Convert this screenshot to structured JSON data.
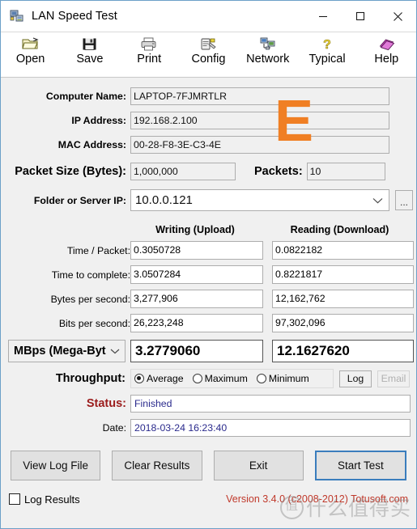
{
  "window": {
    "title": "LAN Speed Test",
    "icon": "app-network-icon",
    "minimize": "–",
    "maximize": "□",
    "close": "✕"
  },
  "toolbar": {
    "items": [
      {
        "label": "Open",
        "icon": "open-folder-icon"
      },
      {
        "label": "Save",
        "icon": "floppy-disk-icon"
      },
      {
        "label": "Print",
        "icon": "printer-icon"
      },
      {
        "label": "Config",
        "icon": "config-gear-icon"
      },
      {
        "label": "Network",
        "icon": "network-icon"
      },
      {
        "label": "Typical",
        "icon": "question-mark-icon"
      },
      {
        "label": "Help",
        "icon": "help-book-icon"
      }
    ]
  },
  "form": {
    "computer_name_label": "Computer Name:",
    "computer_name_value": "LAPTOP-7FJMRTLR",
    "ip_address_label": "IP Address:",
    "ip_address_value": "192.168.2.100",
    "mac_address_label": "MAC Address:",
    "mac_address_value": "00-28-F8-3E-C3-4E",
    "packet_size_label": "Packet Size (Bytes):",
    "packet_size_value": "1,000,000",
    "packets_label": "Packets:",
    "packets_value": "10",
    "folder_label": "Folder or Server IP:",
    "folder_value": "10.0.0.121",
    "browse_button": "...",
    "chevron_icon": "chevron-down-icon"
  },
  "results": {
    "header_write": "Writing (Upload)",
    "header_read": "Reading (Download)",
    "rows": [
      {
        "label": "Time / Packet:",
        "write": "0.3050728",
        "read": "0.0822182"
      },
      {
        "label": "Time to complete:",
        "write": "3.0507284",
        "read": "0.8221817"
      },
      {
        "label": "Bytes per second:",
        "write": "3,277,906",
        "read": "12,162,762"
      },
      {
        "label": "Bits per second:",
        "write": "26,223,248",
        "read": "97,302,096"
      }
    ],
    "unit_selected": "MBps (Mega-Byt",
    "total_write": "3.2779060",
    "total_read": "12.1627620"
  },
  "throughput": {
    "label": "Throughput:",
    "options": [
      {
        "label": "Average",
        "selected": true
      },
      {
        "label": "Maximum",
        "selected": false
      },
      {
        "label": "Minimum",
        "selected": false
      }
    ],
    "log_button": "Log",
    "email_button": "Email"
  },
  "status": {
    "label": "Status:",
    "value": "Finished",
    "date_label": "Date:",
    "date_value": "2018-03-24 16:23:40"
  },
  "actions": {
    "view_log": "View Log File",
    "clear_results": "Clear Results",
    "exit": "Exit",
    "start_test": "Start Test"
  },
  "footer": {
    "log_results_label": "Log Results",
    "version": "Version 3.4.0  (c2008-2012) Totusoft.com"
  },
  "watermarks": {
    "letter": "E",
    "cn_text": "什么值得买",
    "cn_badge": "值"
  },
  "colors": {
    "accent_orange": "#f07f24",
    "status_label": "#9b1c1c",
    "status_value": "#2a2a8c",
    "version_red": "#c0392b",
    "focus_blue": "#3a7dbd",
    "window_border": "#6ca0c8"
  }
}
